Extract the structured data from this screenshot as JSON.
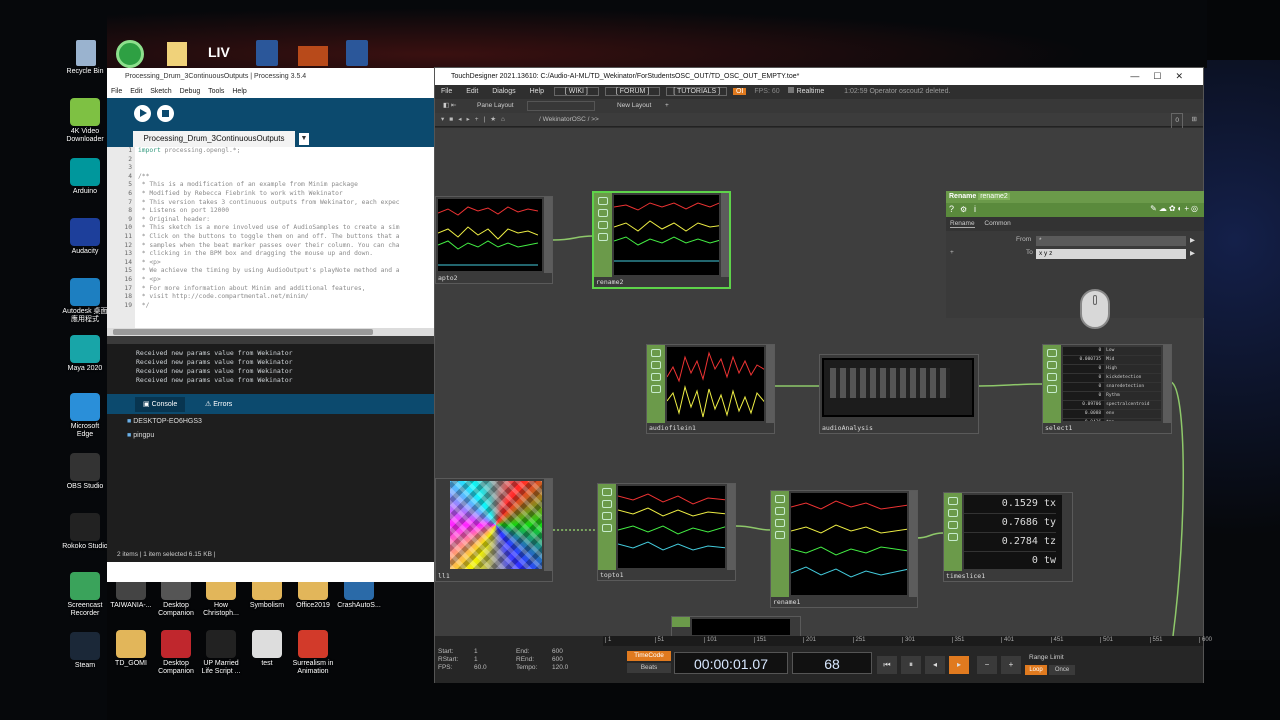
{
  "desktop": {
    "icons": [
      {
        "label": "Recycle Bin",
        "color": "#6a8fb5"
      },
      {
        "label": "4K Video Downloader",
        "color": "#7ec143"
      },
      {
        "label": "Arduino",
        "color": "#00979c"
      },
      {
        "label": "Audacity",
        "color": "#1d3f9b"
      },
      {
        "label": "Autodesk 桌面應用程式",
        "color": "#1d7fc1"
      },
      {
        "label": "Maya 2020",
        "color": "#18a5a8"
      },
      {
        "label": "Microsoft Edge",
        "color": "#2a8fd9"
      },
      {
        "label": "OBS Studio",
        "color": "#333333"
      },
      {
        "label": "Rokoko Studio",
        "color": "#222222"
      },
      {
        "label": "Screencast Recorder",
        "color": "#3aa35b"
      },
      {
        "label": "Steam",
        "color": "#1b2838"
      }
    ],
    "icons2": [
      {
        "label": "TAIWANIA-...",
        "color": "#444444"
      },
      {
        "label": "Desktop Companion",
        "color": "#555555"
      },
      {
        "label": "How Christoph...",
        "color": "#e2b65a"
      },
      {
        "label": "Symbolism",
        "color": "#e2b65a"
      },
      {
        "label": "Office2019",
        "color": "#e2b65a"
      },
      {
        "label": "CrashAutoS...",
        "color": "#2a6aa8"
      },
      {
        "label": "TD_GOMI",
        "color": "#e2b65a"
      },
      {
        "label": "Desktop Companion",
        "color": "#c0272d"
      },
      {
        "label": "UP Married Life Script ...",
        "color": "#222222"
      },
      {
        "label": "test",
        "color": "#dddddd"
      },
      {
        "label": "Surrealism in Animation",
        "color": "#d23a2a"
      }
    ],
    "toprow": [
      "",
      "",
      "LIV",
      "",
      "",
      ""
    ]
  },
  "processing": {
    "title": "Processing_Drum_3ContinuousOutputs | Processing 3.5.4",
    "menu": [
      "File",
      "Edit",
      "Sketch",
      "Debug",
      "Tools",
      "Help"
    ],
    "tab": "Processing_Drum_3ContinuousOutputs",
    "line_numbers": [
      "1",
      "2",
      "3",
      "4",
      "5",
      "6",
      "7",
      "8",
      "9",
      "10",
      "11",
      "12",
      "13",
      "14",
      "15",
      "16",
      "17",
      "18",
      "19"
    ],
    "code_first": "import processing.opengl.*;",
    "code": [
      "",
      "",
      "/**",
      " * This is a modification of an example from Minim package",
      " * Modified by Rebecca Fiebrink to work with Wekinator",
      " * This version takes 3 continuous outputs from Wekinator, each expec",
      " * Listens on port 12000",
      " * Original header:",
      " * This sketch is a more involved use of AudioSamples to create a sim",
      " * Click on the buttons to toggle them on and off. The buttons that a",
      " * samples when the beat marker passes over their column. You can cha",
      " * clicking in the BPM box and dragging the mouse up and down.",
      " * <p>",
      " * We achieve the timing by using AudioOutput's playNote method and a",
      " * <p>",
      " * For more information about Minim and additional features,",
      " * visit http://code.compartmental.net/minim/",
      " */",
      ""
    ],
    "console": [
      "Received new params value from Wekinator",
      "Received new params value from Wekinator",
      "Received new params value from Wekinator",
      "Received new params value from Wekinator"
    ],
    "console_tab": "Console",
    "errors_tab": "Errors",
    "explorer": [
      "DESKTOP-EO6HGS3",
      "pingpu"
    ],
    "status": "2 items  |  1 item selected  6.15 KB  |"
  },
  "td": {
    "title": "TouchDesigner 2021.13610: C:/Audio-AI-ML/TD_Wekinator/ForStudentsOSC_OUT/TD_OSC_OUT_EMPTY.toe*",
    "menu": [
      "File",
      "Edit",
      "Dialogs",
      "Help"
    ],
    "links": [
      "[ WIKI ]",
      "[ FORUM ]",
      "[ TUTORIALS ]"
    ],
    "oi": "OI",
    "fps_label": "FPS: 60",
    "realtime": "Realtime",
    "message": "1:02:59 Operator oscout2 deleted.",
    "pane_layout": "Pane Layout",
    "new_layout": "New Layout",
    "path": "/ WekinatorOSC / >>",
    "pane_num": "0",
    "nodes": {
      "apto2": "apto2",
      "rename2": "rename2",
      "audiofilein1": "audiofilein1",
      "audioAnalysis": "audioAnalysis",
      "select1": "select1",
      "null1": "ll1",
      "topto1": "topto1",
      "rename1": "rename1",
      "timeslice1": "timeslice1"
    },
    "select_channels": [
      [
        "0",
        "Low"
      ],
      [
        "0.000735",
        "Mid"
      ],
      [
        "0",
        "High"
      ],
      [
        "0",
        "kickdetection"
      ],
      [
        "0",
        "snaredetection"
      ],
      [
        "0",
        "Rythm"
      ],
      [
        "0.09706",
        "spectralcentroid"
      ],
      [
        "0.0088",
        "env"
      ],
      [
        "0.0436",
        "tmp"
      ]
    ],
    "timeslice_values": [
      [
        "0.1529",
        "tx"
      ],
      [
        "0.7686",
        "ty"
      ],
      [
        "0.2784",
        "tz"
      ],
      [
        "0",
        "tw"
      ]
    ],
    "param": {
      "op_type": "Rename",
      "op_name": "rename2",
      "tabs": [
        "Rename",
        "Common"
      ],
      "from_label": "From",
      "from_value": "*",
      "to_label": "To",
      "to_value": "x y z"
    },
    "timeline": {
      "ruler": [
        "1",
        "51",
        "101",
        "151",
        "201",
        "251",
        "301",
        "351",
        "401",
        "451",
        "501",
        "551",
        "600"
      ],
      "stats": [
        [
          "Start:",
          "1",
          "End:",
          "600"
        ],
        [
          "RStart:",
          "1",
          "REnd:",
          "600"
        ],
        [
          "FPS:",
          "60.0",
          "Tempo:",
          "120.0"
        ]
      ],
      "timecode_label": "TimeCode",
      "beats_label": "Beats",
      "timecode": "00:00:01.07",
      "frame": "68",
      "range_limit": "Range Limit",
      "loop": "Loop",
      "once": "Once"
    }
  }
}
